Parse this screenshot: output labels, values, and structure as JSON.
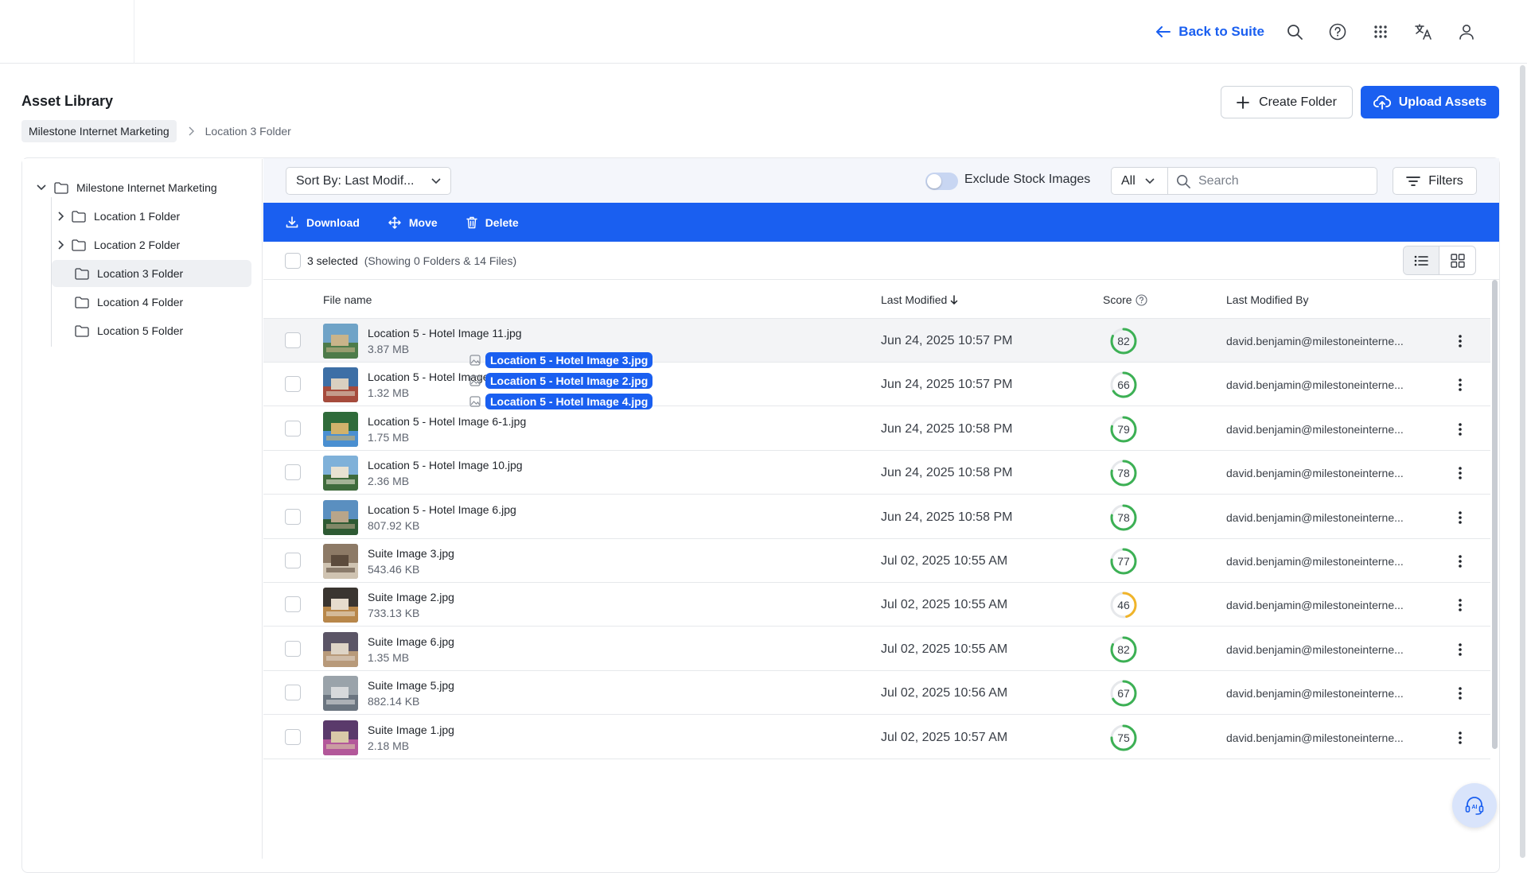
{
  "topbar": {
    "back_label": "Back to Suite",
    "icons": [
      "search-icon",
      "help-circle-icon",
      "apps-grid-icon",
      "translate-icon",
      "user-icon"
    ]
  },
  "header": {
    "title": "Asset Library",
    "breadcrumb": {
      "root": "Milestone Internet Marketing",
      "current": "Location 3 Folder"
    },
    "create_folder_label": "Create Folder",
    "upload_label": "Upload Assets"
  },
  "tree": {
    "root": "Milestone Internet Marketing",
    "items": [
      {
        "label": "Location 1 Folder",
        "expandable": true
      },
      {
        "label": "Location 2 Folder",
        "expandable": true
      },
      {
        "label": "Location 3 Folder",
        "expandable": false,
        "active": true
      },
      {
        "label": "Location 4 Folder",
        "expandable": false
      },
      {
        "label": "Location 5 Folder",
        "expandable": false
      }
    ]
  },
  "toolbar": {
    "sort_label": "Sort By: Last Modif...",
    "exclude_stock_label": "Exclude Stock Images",
    "exclude_stock_on": false,
    "type_filter": "All",
    "search_placeholder": "Search",
    "filters_label": "Filters"
  },
  "actions": {
    "download": "Download",
    "move": "Move",
    "delete": "Delete"
  },
  "selection": {
    "count_text": "3 selected",
    "summary": "(Showing 0 Folders & 14 Files)"
  },
  "columns": {
    "file_name": "File name",
    "last_modified": "Last Modified",
    "score": "Score",
    "last_modified_by": "Last Modified By"
  },
  "drag_items": [
    "Location 5 - Hotel Image 3.jpg",
    "Location 5 - Hotel Image 2.jpg",
    "Location 5 - Hotel Image 4.jpg"
  ],
  "files": [
    {
      "name": "Location 5 - Hotel Image 11.jpg",
      "size": "3.87 MB",
      "modified": "Jun 24, 2025 10:57 PM",
      "score": 82,
      "by": "david.benjamin@milestoneinterne..."
    },
    {
      "name": "Location 5 - Hotel Image 3.jpg",
      "size": "1.32 MB",
      "modified": "Jun 24, 2025 10:57 PM",
      "score": 66,
      "by": "david.benjamin@milestoneinterne..."
    },
    {
      "name": "Location 5 - Hotel Image 6-1.jpg",
      "size": "1.75 MB",
      "modified": "Jun 24, 2025 10:58 PM",
      "score": 79,
      "by": "david.benjamin@milestoneinterne..."
    },
    {
      "name": "Location 5 - Hotel Image 10.jpg",
      "size": "2.36 MB",
      "modified": "Jun 24, 2025 10:58 PM",
      "score": 78,
      "by": "david.benjamin@milestoneinterne..."
    },
    {
      "name": "Location 5 - Hotel Image 6.jpg",
      "size": "807.92 KB",
      "modified": "Jun 24, 2025 10:58 PM",
      "score": 78,
      "by": "david.benjamin@milestoneinterne..."
    },
    {
      "name": "Suite Image 3.jpg",
      "size": "543.46 KB",
      "modified": "Jul 02, 2025 10:55 AM",
      "score": 77,
      "by": "david.benjamin@milestoneinterne..."
    },
    {
      "name": "Suite Image 2.jpg",
      "size": "733.13 KB",
      "modified": "Jul 02, 2025 10:55 AM",
      "score": 46,
      "by": "david.benjamin@milestoneinterne..."
    },
    {
      "name": "Suite Image 6.jpg",
      "size": "1.35 MB",
      "modified": "Jul 02, 2025 10:55 AM",
      "score": 82,
      "by": "david.benjamin@milestoneinterne..."
    },
    {
      "name": "Suite Image 5.jpg",
      "size": "882.14 KB",
      "modified": "Jul 02, 2025 10:56 AM",
      "score": 67,
      "by": "david.benjamin@milestoneinterne..."
    },
    {
      "name": "Suite Image 1.jpg",
      "size": "2.18 MB",
      "modified": "Jul 02, 2025 10:57 AM",
      "score": 75,
      "by": "david.benjamin@milestoneinterne..."
    }
  ],
  "colors": {
    "accent": "#1a5ff0",
    "score_high": "#3cb054",
    "score_mid": "#f0b429"
  }
}
